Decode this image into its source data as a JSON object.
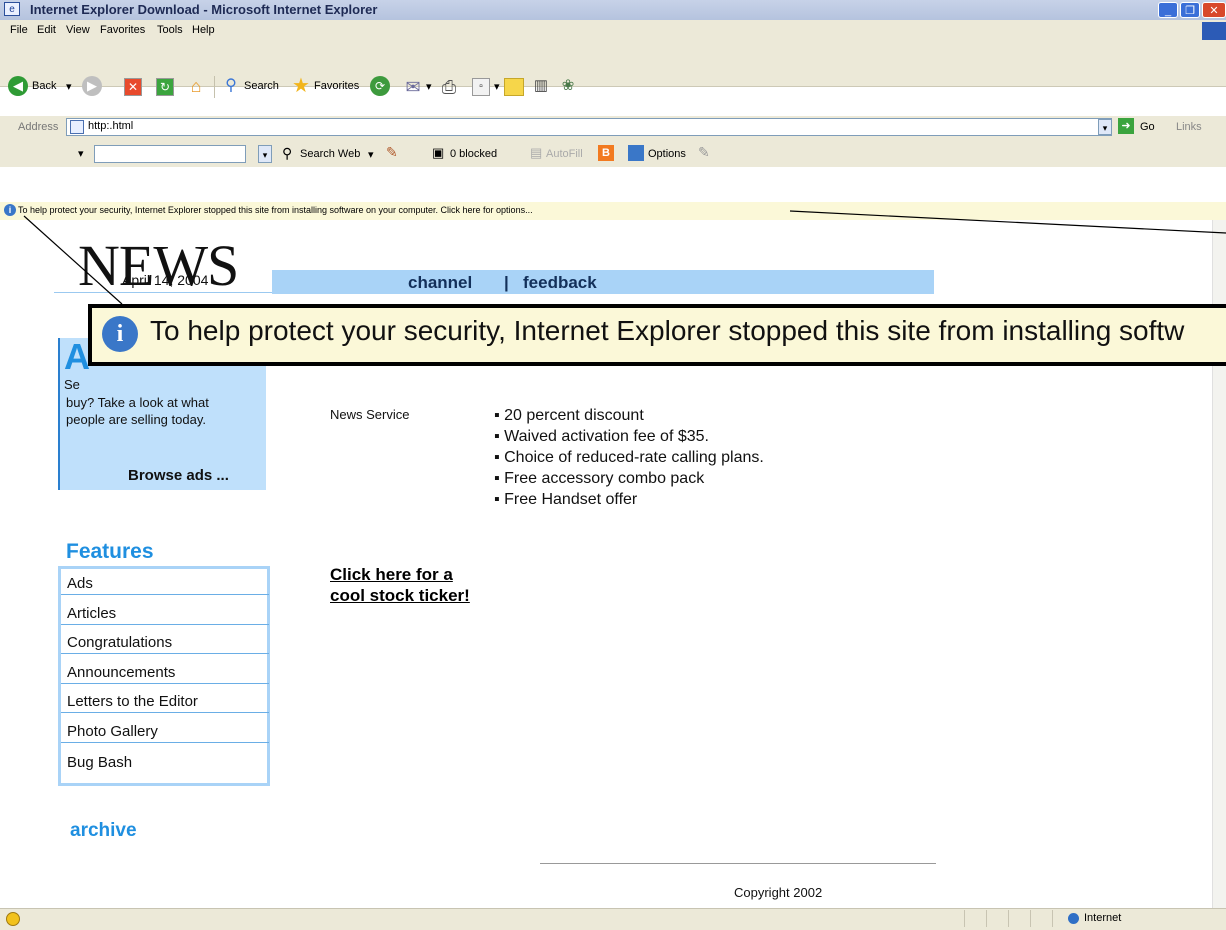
{
  "window": {
    "title": "Internet Explorer Download - Microsoft Internet Explorer"
  },
  "menu": [
    "File",
    "Edit",
    "View",
    "Favorites",
    "Tools",
    "Help"
  ],
  "toolbar": {
    "back": "Back",
    "search": "Search",
    "favorites": "Favorites"
  },
  "address": {
    "label": "Address",
    "value": "http:.html",
    "go": "Go",
    "links": "Links"
  },
  "searchbar": {
    "search_web": "Search Web",
    "blocked": "0 blocked",
    "autofill": "AutoFill",
    "options": "Options"
  },
  "infobar": {
    "text": "To help protect your security, Internet Explorer stopped this site from installing software on your computer.  Click here for options..."
  },
  "callout": {
    "text": "To help protect your security, Internet Explorer stopped this site from installing softw"
  },
  "page": {
    "logo": "NEWS",
    "date": "April 14, 2004",
    "nav": {
      "channel": "channel",
      "sep": "|",
      "feedback": "feedback"
    },
    "ads_box": {
      "text_partial": "Se",
      "body": "buy? Take a look at what people are selling today.",
      "link": "Browse ads ...",
      "heading_partial": "A"
    },
    "news_service": "News Service",
    "bullets": [
      "20 percent discount",
      "Waived activation fee of $35.",
      "Choice of reduced-rate calling plans.",
      "Free accessory combo pack",
      "Free Handset offer"
    ],
    "features_title": "Features",
    "features": [
      "Ads",
      "Articles",
      "Congratulations",
      "Announcements",
      "Letters to the Editor",
      "Photo Gallery",
      "Bug Bash"
    ],
    "ticker_link": [
      "Click here for a",
      "cool stock ticker!"
    ],
    "archive": "archive",
    "copyright": "Copyright 2002"
  },
  "status": {
    "zone": "Internet"
  },
  "colors": {
    "accent_blue": "#1f8fe0",
    "nav_bar": "#a9d3f7",
    "infobar_bg": "#fbf8d8"
  }
}
